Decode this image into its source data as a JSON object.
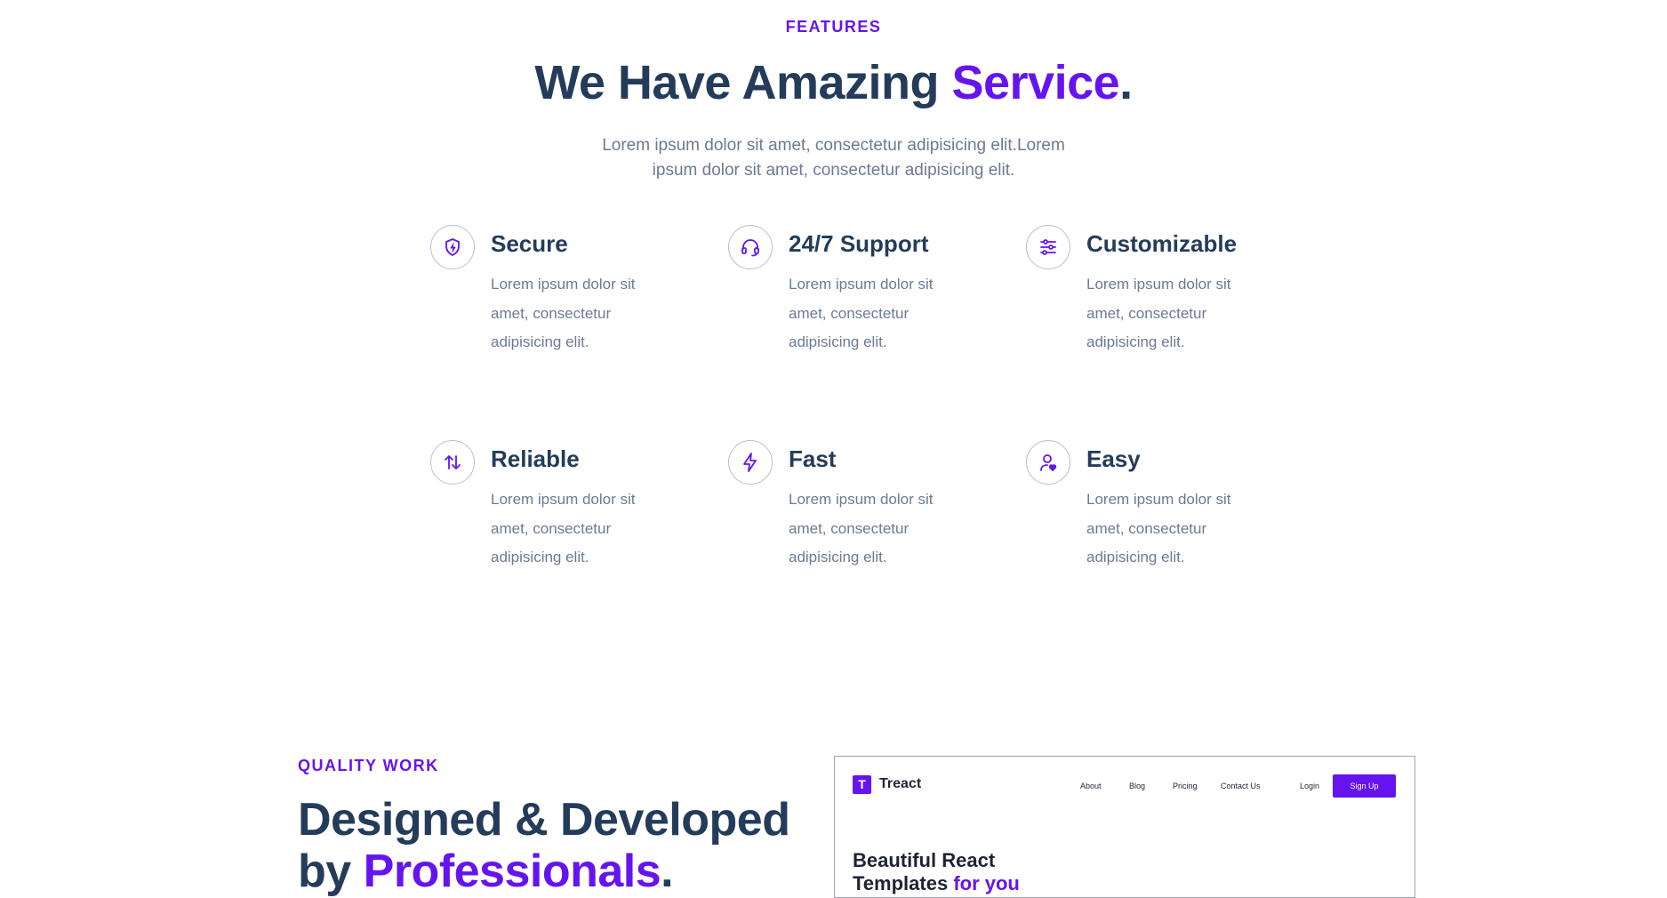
{
  "features": {
    "eyebrow": "FEATURES",
    "title_main": "We Have Amazing ",
    "title_accent": "Service",
    "title_end": ".",
    "subtitle": "Lorem ipsum dolor sit amet, consectetur adipisicing elit.Lorem ipsum dolor sit amet, consectetur adipisicing elit.",
    "items": [
      {
        "title": "Secure",
        "desc": "Lorem ipsum dolor sit amet, consectetur adipisicing elit.",
        "icon": "shield-bolt-icon"
      },
      {
        "title": "24/7 Support",
        "desc": "Lorem ipsum dolor sit amet, consectetur adipisicing elit.",
        "icon": "headset-icon"
      },
      {
        "title": "Customizable",
        "desc": "Lorem ipsum dolor sit amet, consectetur adipisicing elit.",
        "icon": "sliders-icon"
      },
      {
        "title": "Reliable",
        "desc": "Lorem ipsum dolor sit amet, consectetur adipisicing elit.",
        "icon": "arrows-up-down-icon"
      },
      {
        "title": "Fast",
        "desc": "Lorem ipsum dolor sit amet, consectetur adipisicing elit.",
        "icon": "lightning-icon"
      },
      {
        "title": "Easy",
        "desc": "Lorem ipsum dolor sit amet, consectetur adipisicing elit.",
        "icon": "user-heart-icon"
      }
    ]
  },
  "quality": {
    "eyebrow": "QUALITY WORK",
    "title_line1": "Designed & Developed",
    "title_line2_main": "by ",
    "title_line2_accent": "Professionals",
    "title_line2_end": "."
  },
  "preview": {
    "logo_letter": "T",
    "brand": "Treact",
    "nav": [
      "About",
      "Blog",
      "Pricing",
      "Contact Us"
    ],
    "login": "Login",
    "signup": "Sign Up",
    "hero_line1": "Beautiful React",
    "hero_line2_main": "Templates ",
    "hero_line2_accent": "for you"
  },
  "colors": {
    "accent": "#6514ef",
    "heading": "#243c5a",
    "body_text": "#6b7b93"
  }
}
